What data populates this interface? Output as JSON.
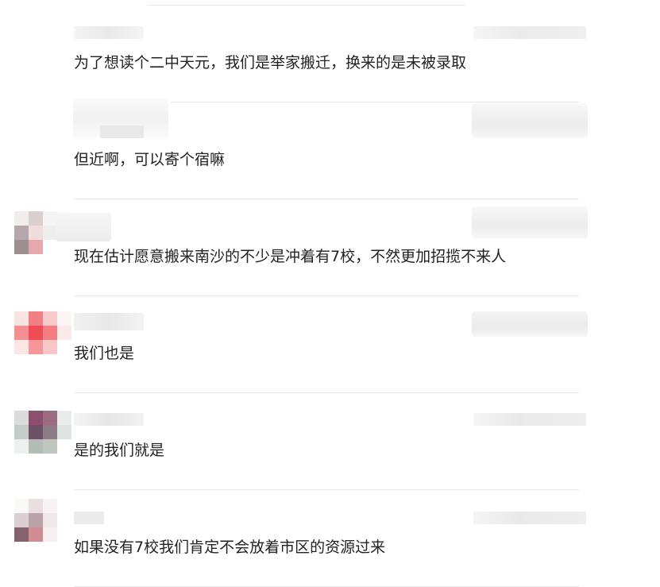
{
  "comments": [
    {
      "text": "为了想读个二中天元，我们是举家搬迁，换来的是未被录取"
    },
    {
      "text": "但近啊，可以寄个宿嘛"
    },
    {
      "text": "现在估计愿意搬来南沙的不少是冲着有7校，不然更加招揽不来人"
    },
    {
      "text": "我们也是"
    },
    {
      "text": "是的我们就是"
    },
    {
      "text": "如果没有7校我们肯定不会放着市区的资源过来"
    }
  ],
  "colors": {
    "text": "#222222",
    "divider": "#e8e8e8",
    "blur": "#ededed"
  }
}
